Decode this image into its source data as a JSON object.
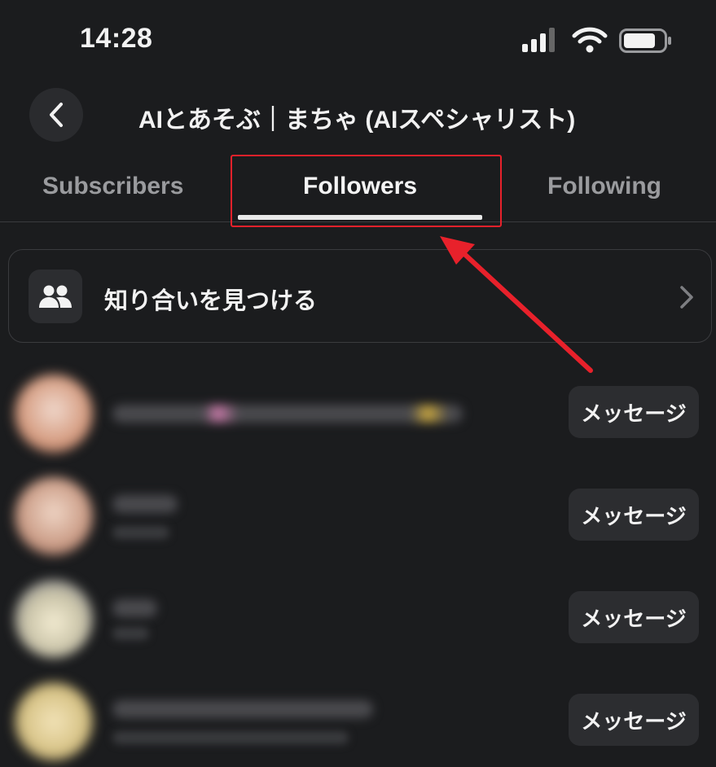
{
  "status_bar": {
    "time": "14:28"
  },
  "header": {
    "title": "AIとあそぶ｜まちゃ (AIスペシャリスト)"
  },
  "tabs": [
    {
      "label": "Subscribers",
      "active": false
    },
    {
      "label": "Followers",
      "active": true
    },
    {
      "label": "Following",
      "active": false
    }
  ],
  "find_contacts": {
    "label": "知り合いを見つける"
  },
  "followers": [
    {
      "message_label": "メッセージ"
    },
    {
      "message_label": "メッセージ"
    },
    {
      "message_label": "メッセージ"
    },
    {
      "message_label": "メッセージ"
    }
  ],
  "colors": {
    "background": "#1b1c1e",
    "annotation": "#e8212b",
    "button": "#2c2d30"
  }
}
